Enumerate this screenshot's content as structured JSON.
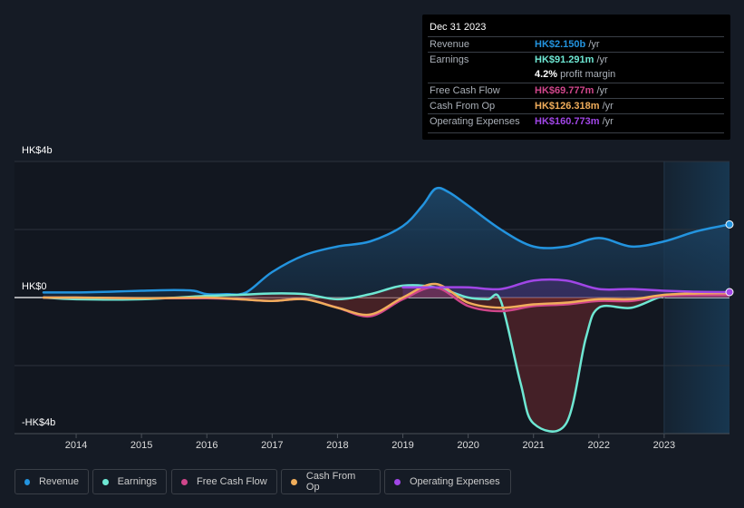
{
  "tooltip": {
    "date": "Dec 31 2023",
    "rows": [
      {
        "label": "Revenue",
        "value": "HK$2.150b",
        "unit": " /yr",
        "color": "#2394df"
      },
      {
        "label": "Earnings",
        "value": "HK$91.291m",
        "unit": " /yr",
        "color": "#6ee7d3"
      },
      {
        "label": "",
        "value": "4.2%",
        "unit": " profit margin",
        "color": "#ffffff"
      },
      {
        "label": "Free Cash Flow",
        "value": "HK$69.777m",
        "unit": " /yr",
        "color": "#d0468b"
      },
      {
        "label": "Cash From Op",
        "value": "HK$126.318m",
        "unit": " /yr",
        "color": "#f0ad5b"
      },
      {
        "label": "Operating Expenses",
        "value": "HK$160.773m",
        "unit": " /yr",
        "color": "#a046e6"
      }
    ]
  },
  "legend": [
    {
      "label": "Revenue",
      "color": "#2394df"
    },
    {
      "label": "Earnings",
      "color": "#6ee7d3"
    },
    {
      "label": "Free Cash Flow",
      "color": "#d0468b"
    },
    {
      "label": "Cash From Op",
      "color": "#f0ad5b"
    },
    {
      "label": "Operating Expenses",
      "color": "#a046e6"
    }
  ],
  "chart_data": {
    "type": "line",
    "title": "",
    "xlabel": "",
    "ylabel": "",
    "currency": "HK$",
    "y_tick_labels": [
      "HK$4b",
      "HK$0",
      "-HK$4b"
    ],
    "y_ticks": [
      4,
      0,
      -4
    ],
    "ylim": [
      -4,
      4
    ],
    "y_unit": "billions",
    "x_tick_labels": [
      "2014",
      "2015",
      "2016",
      "2017",
      "2018",
      "2019",
      "2020",
      "2021",
      "2022",
      "2023"
    ],
    "xlim": [
      2013.5,
      2024.0
    ],
    "grid": true,
    "highlight_region": [
      2023.0,
      2024.0
    ],
    "legend_position": "bottom",
    "series": [
      {
        "name": "Revenue",
        "color": "#2394df",
        "x": [
          2013.5,
          2014.0,
          2014.5,
          2015.0,
          2015.5,
          2015.8,
          2016.0,
          2016.3,
          2016.6,
          2017.0,
          2017.5,
          2018.0,
          2018.5,
          2019.0,
          2019.3,
          2019.5,
          2019.7,
          2020.0,
          2020.5,
          2021.0,
          2021.5,
          2022.0,
          2022.5,
          2023.0,
          2023.5,
          2024.0
        ],
        "values": [
          0.15,
          0.15,
          0.17,
          0.2,
          0.22,
          0.2,
          0.1,
          0.1,
          0.15,
          0.75,
          1.25,
          1.5,
          1.65,
          2.1,
          2.7,
          3.2,
          3.1,
          2.7,
          2.0,
          1.5,
          1.5,
          1.75,
          1.5,
          1.65,
          1.95,
          2.15
        ]
      },
      {
        "name": "Earnings",
        "color": "#6ee7d3",
        "x": [
          2013.5,
          2014.0,
          2015.0,
          2016.0,
          2016.5,
          2017.0,
          2017.5,
          2018.0,
          2018.5,
          2019.0,
          2019.5,
          2020.0,
          2020.3,
          2020.5,
          2020.8,
          2021.0,
          2021.5,
          2021.8,
          2022.0,
          2022.5,
          2023.0,
          2023.5,
          2024.0
        ],
        "values": [
          0.0,
          -0.05,
          -0.05,
          0.05,
          0.08,
          0.12,
          0.1,
          -0.05,
          0.1,
          0.35,
          0.3,
          0.0,
          -0.05,
          -0.1,
          -2.5,
          -3.7,
          -3.7,
          -1.2,
          -0.3,
          -0.3,
          0.05,
          0.09,
          0.09
        ]
      },
      {
        "name": "Free Cash Flow",
        "color": "#d0468b",
        "x": [
          2013.5,
          2014.0,
          2015.0,
          2016.0,
          2016.5,
          2017.0,
          2017.5,
          2018.0,
          2018.5,
          2019.0,
          2019.5,
          2020.0,
          2020.5,
          2021.0,
          2021.5,
          2022.0,
          2022.5,
          2023.0,
          2023.5,
          2024.0
        ],
        "values": [
          0.0,
          0.0,
          -0.02,
          -0.02,
          -0.05,
          -0.1,
          -0.05,
          -0.3,
          -0.55,
          -0.05,
          0.3,
          -0.25,
          -0.4,
          -0.25,
          -0.2,
          -0.1,
          -0.1,
          0.05,
          0.07,
          0.07
        ]
      },
      {
        "name": "Cash From Op",
        "color": "#f0ad5b",
        "x": [
          2013.5,
          2014.0,
          2015.0,
          2016.0,
          2016.5,
          2017.0,
          2017.5,
          2018.0,
          2018.5,
          2019.0,
          2019.5,
          2020.0,
          2020.5,
          2021.0,
          2021.5,
          2022.0,
          2022.5,
          2023.0,
          2023.5,
          2024.0
        ],
        "values": [
          0.0,
          0.0,
          -0.02,
          0.0,
          -0.05,
          -0.1,
          -0.05,
          -0.3,
          -0.5,
          0.0,
          0.4,
          -0.15,
          -0.3,
          -0.2,
          -0.15,
          -0.05,
          -0.05,
          0.08,
          0.12,
          0.13
        ]
      },
      {
        "name": "Operating Expenses",
        "color": "#a046e6",
        "x": [
          2019.0,
          2019.5,
          2020.0,
          2020.5,
          2021.0,
          2021.5,
          2022.0,
          2022.5,
          2023.0,
          2023.5,
          2024.0
        ],
        "values": [
          0.3,
          0.3,
          0.3,
          0.25,
          0.5,
          0.5,
          0.25,
          0.25,
          0.2,
          0.17,
          0.16
        ]
      }
    ]
  }
}
